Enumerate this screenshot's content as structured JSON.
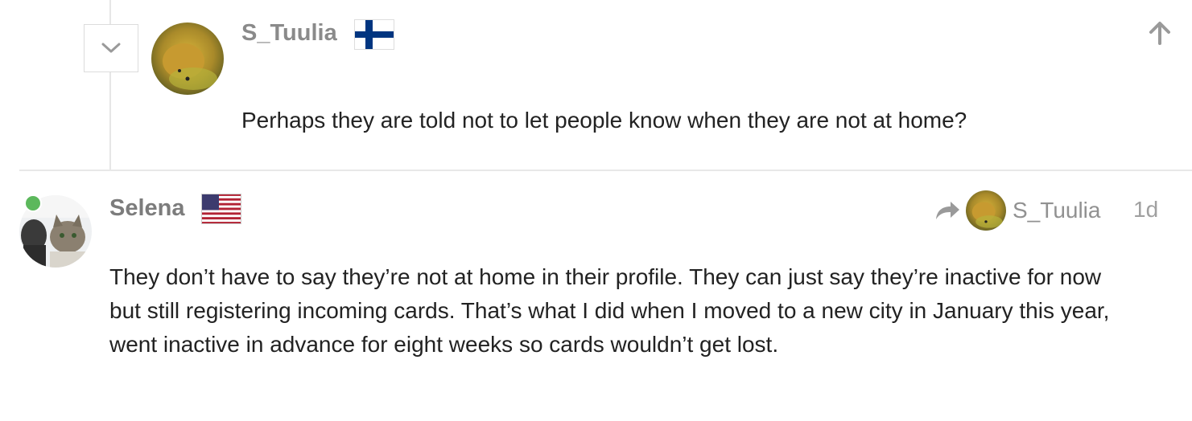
{
  "reply": {
    "username": "S_Tuulia",
    "flag": "finland-flag",
    "text": "Perhaps they are told not to let people know when they are not at home?"
  },
  "post": {
    "username": "Selena",
    "flag": "usa-flag",
    "reply_to_username": "S_Tuulia",
    "date": "1d",
    "online": true,
    "body_lines": [
      "They don’t have to say they’re not at home in their profile. They can just say they’re inactive for now",
      "but still registering incoming cards. That’s what I did when I moved to a new city in January this year,",
      "went inactive in advance for eight weeks so cards wouldn’t get lost."
    ]
  },
  "colors": {
    "online": "#5cb85c",
    "muted_text": "#919191",
    "divider": "#e8e8e8"
  }
}
